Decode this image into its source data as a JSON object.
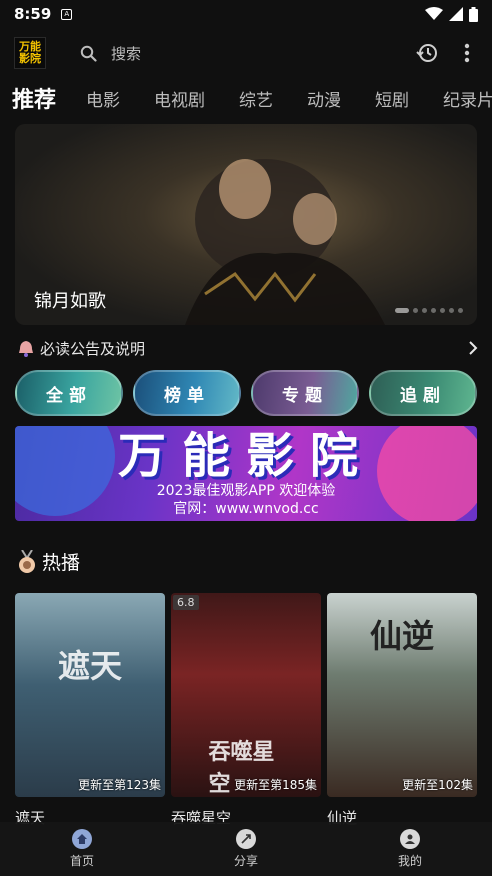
{
  "status_bar": {
    "time": "8:59",
    "sim_label": "A"
  },
  "app": {
    "logo_line1": "万能",
    "logo_line2": "影院"
  },
  "search": {
    "placeholder": "搜索"
  },
  "category_tabs": [
    {
      "label": "推荐",
      "active": true
    },
    {
      "label": "电影"
    },
    {
      "label": "电视剧"
    },
    {
      "label": "综艺"
    },
    {
      "label": "动漫"
    },
    {
      "label": "短剧"
    },
    {
      "label": "纪录片"
    }
  ],
  "banner": {
    "title": "锦月如歌",
    "slide_count": 7,
    "active_slide": 1
  },
  "notice": {
    "text": "必读公告及说明",
    "icon": "bell-icon"
  },
  "quick_pills": [
    {
      "label": "全部"
    },
    {
      "label": "榜单"
    },
    {
      "label": "专题"
    },
    {
      "label": "追剧"
    }
  ],
  "promo": {
    "title": "万能影院",
    "subtitle": "2023最佳观影APP 欢迎体验",
    "website": "官网：www.wnvod.cc"
  },
  "hot": {
    "title": "热播",
    "items": [
      {
        "name": "遮天",
        "update": "更新至第123集",
        "art": "遮天"
      },
      {
        "name": "吞噬星空",
        "update": "更新至第185集",
        "rating": "6.8",
        "art": "吞噬星空"
      },
      {
        "name": "仙逆",
        "update": "更新至102集",
        "art": "仙逆"
      }
    ]
  },
  "bottom_nav": [
    {
      "label": "首页",
      "icon": "home-icon",
      "active": true
    },
    {
      "label": "分享",
      "icon": "share-icon"
    },
    {
      "label": "我的",
      "icon": "profile-icon"
    }
  ],
  "colors": {
    "background": "#101010",
    "accent": "#f3c200"
  }
}
